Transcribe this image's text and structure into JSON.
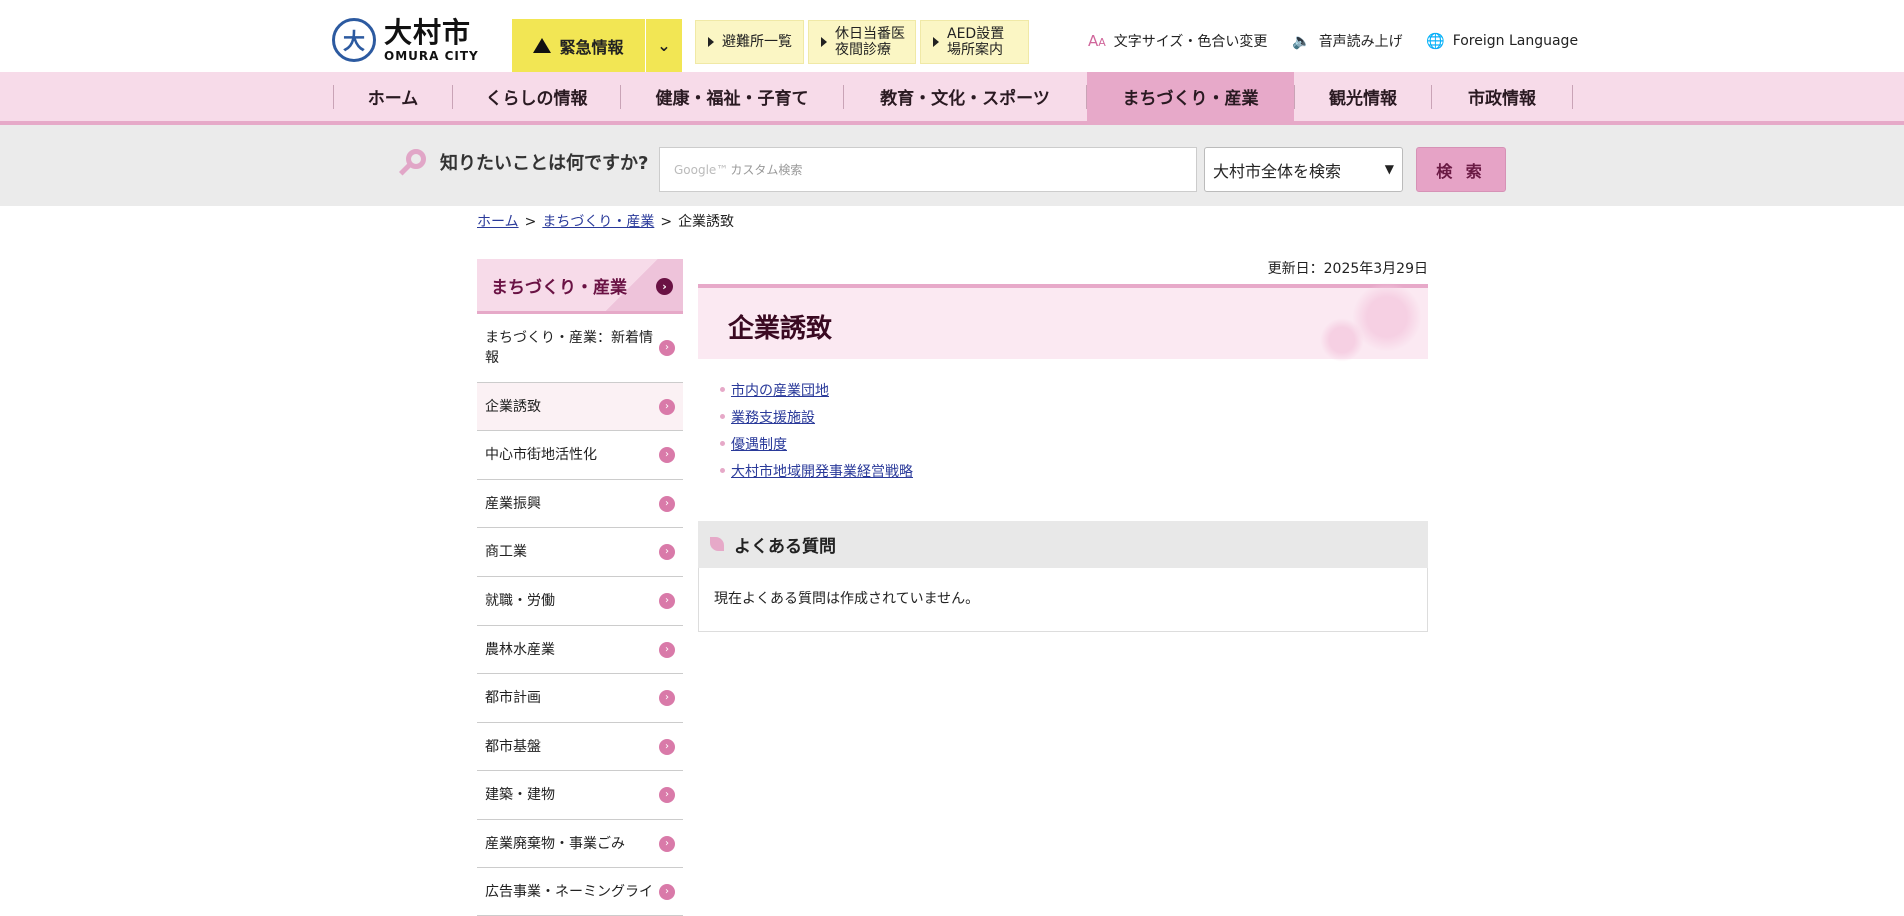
{
  "header": {
    "logo_jp": "大村市",
    "logo_en": "OMURA CITY",
    "emergency_label": "緊急情報",
    "quick_links": [
      {
        "line1": "避難所一覧",
        "line2": ""
      },
      {
        "line1": "休日当番医",
        "line2": "夜間診療"
      },
      {
        "line1": "AED設置",
        "line2": "場所案内"
      }
    ],
    "utilities": {
      "font_color": "文字サイズ・色合い変更",
      "voice": "音声読み上げ",
      "language": "Foreign Language"
    }
  },
  "nav": {
    "items": [
      "ホーム",
      "くらしの情報",
      "健康・福祉・子育て",
      "教育・文化・スポーツ",
      "まちづくり・産業",
      "観光情報",
      "市政情報"
    ],
    "active": "まちづくり・産業"
  },
  "search": {
    "label": "知りたいことは何ですか?",
    "google_mark": "Google™",
    "placeholder": "カスタム検索",
    "scope_selected": "大村市全体を検索",
    "button": "検 索"
  },
  "breadcrumb": {
    "home": "ホーム",
    "section": "まちづくり・産業",
    "current": "企業誘致",
    "separator": ">"
  },
  "sidebar": {
    "heading": "まちづくり・産業",
    "items": [
      "まちづくり・産業：新着情報",
      "企業誘致",
      "中心市街地活性化",
      "産業振興",
      "商工業",
      "就職・労働",
      "農林水産業",
      "都市計画",
      "都市基盤",
      "建築・建物",
      "産業廃棄物・事業ごみ",
      "広告事業・ネーミングライ"
    ],
    "current": "企業誘致"
  },
  "main": {
    "updated": "更新日：2025年3月29日",
    "title": "企業誘致",
    "links": [
      "市内の産業団地",
      "業務支援施設",
      "優遇制度",
      "大村市地域開発事業経営戦略"
    ],
    "faq_heading": "よくある質問",
    "faq_body": "現在よくある質問は作成されていません。"
  },
  "colors": {
    "nav_bg": "#f7dbe9",
    "nav_active": "#e7a9c9",
    "emergency": "#f2e654",
    "accent_dark": "#6a1244"
  }
}
